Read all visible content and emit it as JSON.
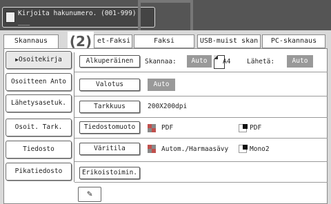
{
  "hint": {
    "text": "Kirjoita hakunumero. (001-999)",
    "value": "___"
  },
  "callout": {
    "label": "(2)"
  },
  "tabs": [
    {
      "label": "Skannaus"
    },
    {
      "label": "et-Faksi"
    },
    {
      "label": "Faksi"
    },
    {
      "label": "USB-muist skan"
    },
    {
      "label": "PC-skannaus"
    }
  ],
  "sidebar": {
    "items": [
      {
        "label": "Osoitekirja"
      },
      {
        "label": "Osoitteen Anto"
      },
      {
        "label": "Lähetysasetuk."
      },
      {
        "label": "Osoit. Tark."
      },
      {
        "label": "Tiedosto"
      },
      {
        "label": "Pikatiedosto"
      }
    ]
  },
  "rows": {
    "original": {
      "button": "Alkuperäinen",
      "scan_label": "Skannaa:",
      "scan_value": "Auto",
      "paper_size": "A4",
      "send_label": "Lähetä:",
      "send_value": "Auto"
    },
    "exposure": {
      "button": "Valotus",
      "value": "Auto"
    },
    "resolution": {
      "button": "Tarkkuus",
      "value": "200X200dpi"
    },
    "file_format": {
      "button": "Tiedostomuoto",
      "color_value": "PDF",
      "mono_value": "PDF"
    },
    "color_mode": {
      "button": "Väritila",
      "color_value": "Autom./Harmaasävy",
      "mono_value": "Mono2"
    },
    "special": {
      "button": "Erikoistoimin."
    }
  },
  "icons": {
    "hint_icon": "address-book-icon",
    "bottom_icon": "write-pen-icon"
  },
  "colors": {
    "topbar": "#555555",
    "chip": "#999999",
    "swatch_red": "#c0504d",
    "swatch_gray": "#888888"
  }
}
